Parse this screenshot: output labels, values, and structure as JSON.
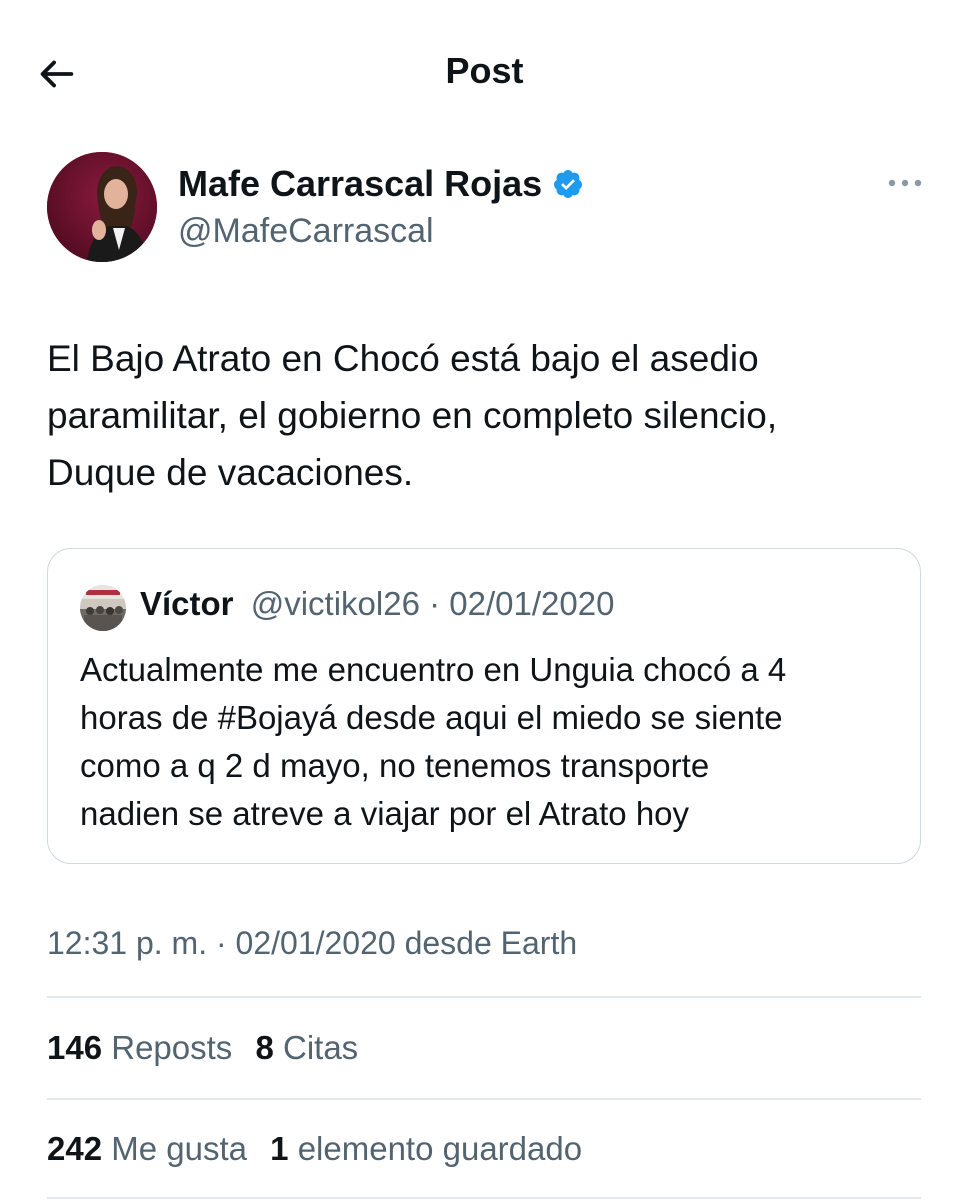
{
  "header": {
    "title": "Post",
    "back_icon": "arrow-left-icon"
  },
  "author": {
    "name": "Mafe Carrascal Rojas",
    "handle": "@MafeCarrascal",
    "verified_icon": "verified-badge-icon",
    "verified_color": "#1d9bf0"
  },
  "tweet": {
    "lines": [
      "El Bajo Atrato en Chocó está bajo el asedio",
      "paramilitar, el gobierno en completo silencio,",
      "Duque de vacaciones."
    ]
  },
  "quote": {
    "name": "Víctor",
    "handle": "@victikol26",
    "separator": " · ",
    "date": "02/01/2020",
    "lines": [
      "Actualmente me encuentro en Unguia chocó a 4",
      "horas de #Bojayá desde aqui el miedo se siente",
      "como a q 2 d mayo, no tenemos transporte",
      "nadien se atreve a viajar por el Atrato hoy"
    ]
  },
  "meta": {
    "text": "12:31 p. m. · 02/01/2020 desde Earth"
  },
  "stats_row1": {
    "reposts_count": "146",
    "reposts_label": "Reposts",
    "quotes_count": "8",
    "quotes_label": "Citas"
  },
  "stats_row2": {
    "likes_count": "242",
    "likes_label": "Me gusta",
    "bookmarks_count": "1",
    "bookmarks_label": "elemento guardado"
  },
  "colors": {
    "text_primary": "#0f1419",
    "text_secondary": "#536471",
    "border": "#cfd9de",
    "accent": "#1d9bf0"
  }
}
